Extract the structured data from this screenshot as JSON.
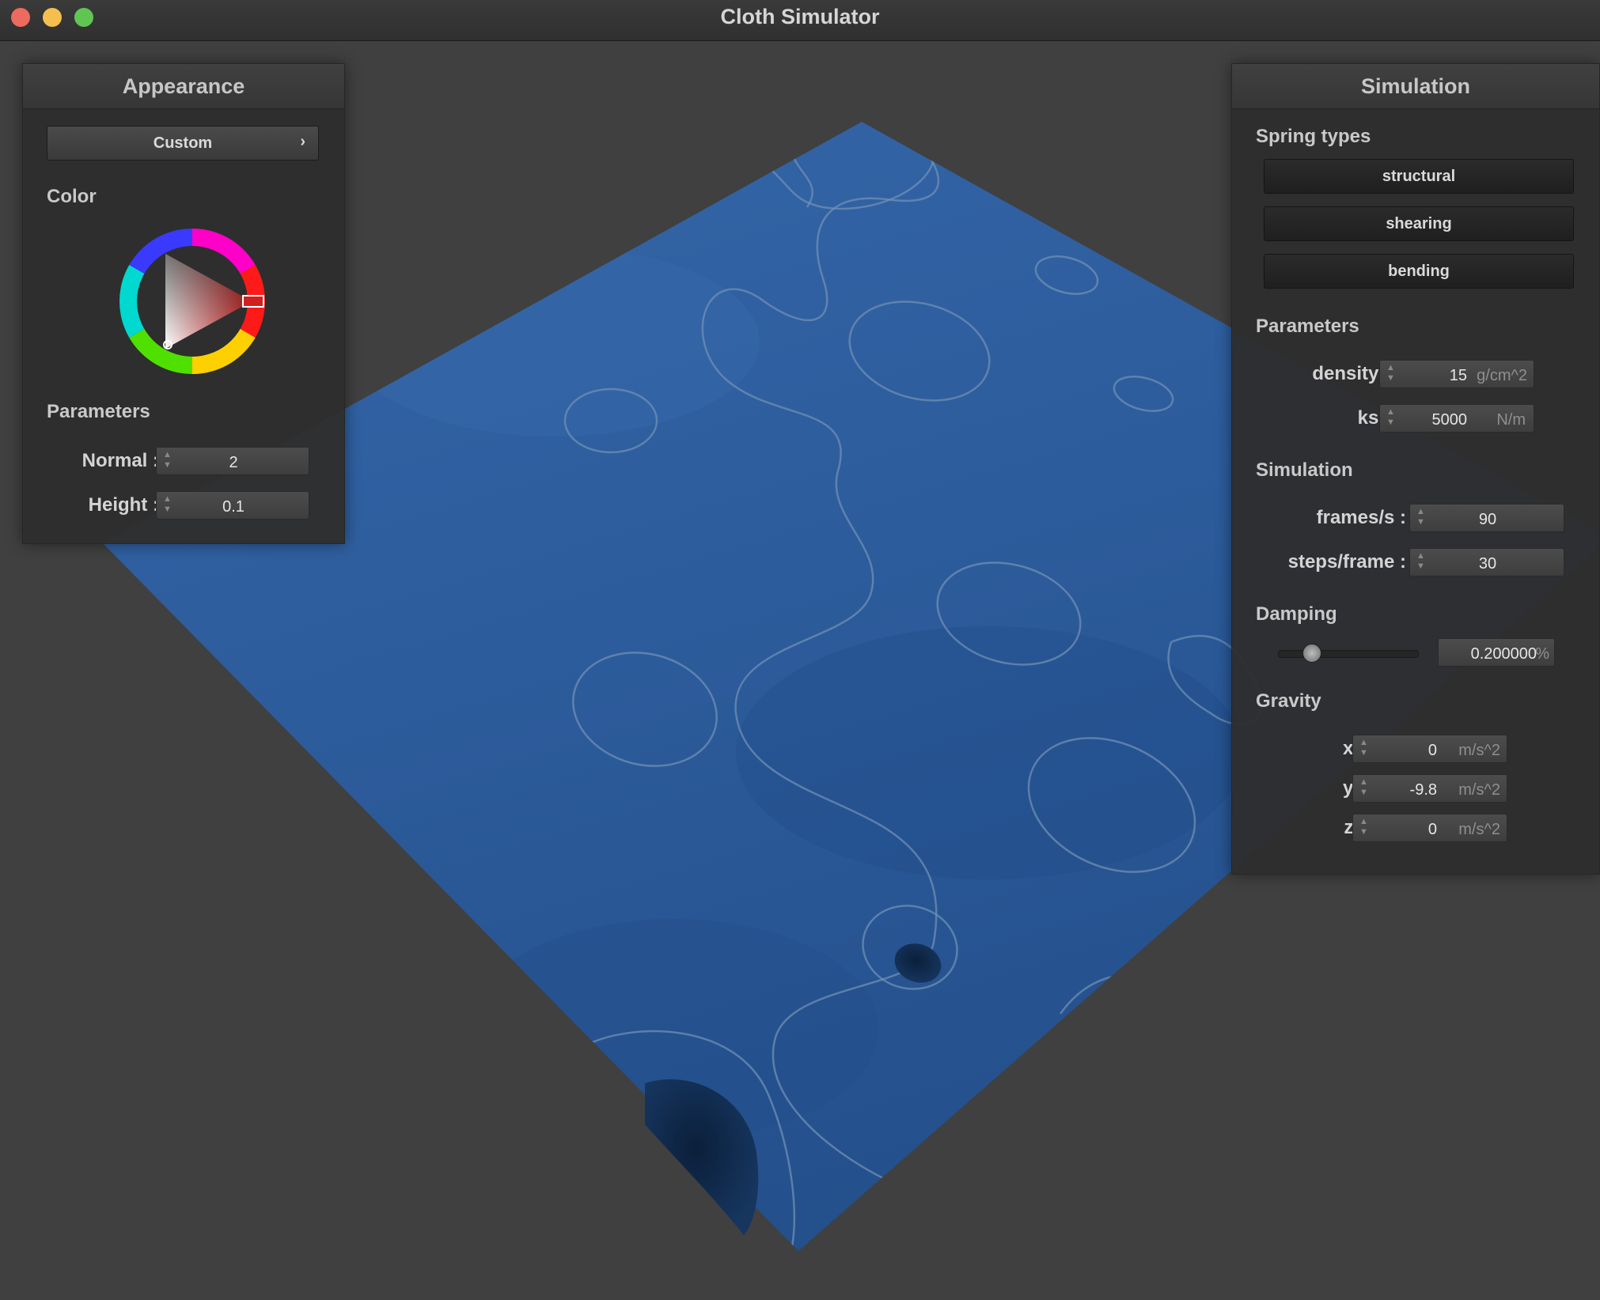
{
  "window": {
    "title": "Cloth Simulator"
  },
  "appearance": {
    "title": "Appearance",
    "preset_label": "Custom",
    "preset_chevron": "›",
    "color_label": "Color",
    "color_value": "#d02020",
    "parameters_label": "Parameters",
    "normal_label": "Normal :",
    "normal_value": "2",
    "height_label": "Height :",
    "height_value": "0.1"
  },
  "simulation": {
    "title": "Simulation",
    "spring_types_label": "Spring types",
    "spring_types": [
      "structural",
      "shearing",
      "bending"
    ],
    "parameters_label": "Parameters",
    "density_label": "density :",
    "density_value": "15",
    "density_unit": "g/cm^2",
    "ks_label": "ks :",
    "ks_value": "5000",
    "ks_unit": "N/m",
    "sim_label": "Simulation",
    "fps_label": "frames/s :",
    "fps_value": "90",
    "steps_label": "steps/frame :",
    "steps_value": "30",
    "damping_label": "Damping",
    "damping_value": "0.200000",
    "damping_unit": "%",
    "damping_fraction": 0.2,
    "gravity_label": "Gravity",
    "gx_label": "x :",
    "gx_value": "0",
    "gy_label": "y :",
    "gy_value": "-9.8",
    "gz_label": "z :",
    "gz_value": "0",
    "gravity_unit": "m/s^2"
  },
  "colors": {
    "cloth": "#2f5f9e",
    "background": "#404040",
    "panel": "#2e2e2e"
  }
}
